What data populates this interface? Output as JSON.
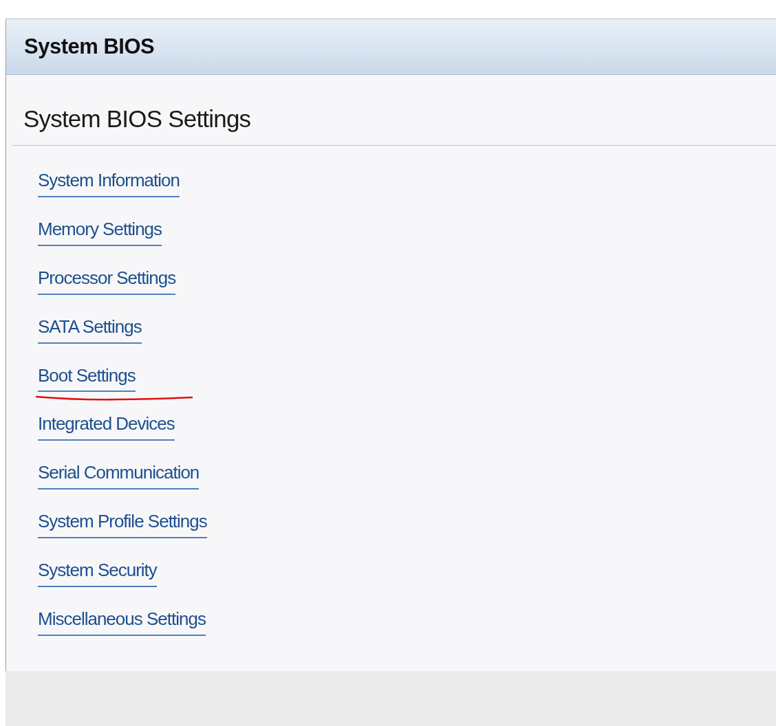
{
  "header": {
    "title": "System BIOS"
  },
  "page": {
    "heading": "System BIOS Settings"
  },
  "links": [
    {
      "label": "System Information",
      "annotated": false
    },
    {
      "label": "Memory Settings",
      "annotated": false
    },
    {
      "label": "Processor Settings",
      "annotated": false
    },
    {
      "label": "SATA Settings",
      "annotated": false
    },
    {
      "label": "Boot Settings",
      "annotated": true
    },
    {
      "label": "Integrated Devices",
      "annotated": false
    },
    {
      "label": "Serial Communication",
      "annotated": false
    },
    {
      "label": "System Profile Settings",
      "annotated": false
    },
    {
      "label": "System Security",
      "annotated": false
    },
    {
      "label": "Miscellaneous Settings",
      "annotated": false
    }
  ]
}
